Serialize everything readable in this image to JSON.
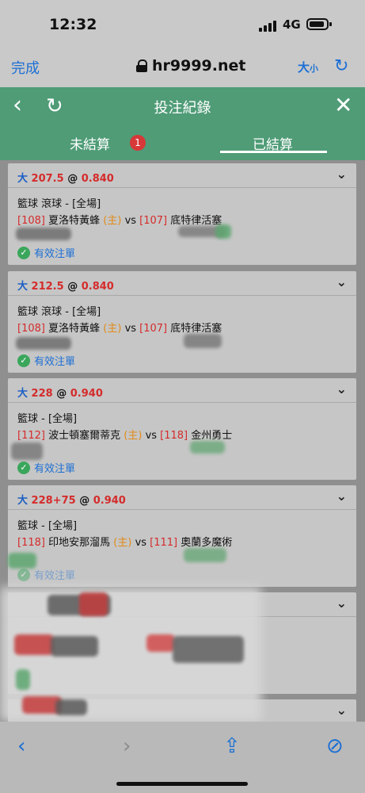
{
  "status": {
    "time": "12:32",
    "network": "4G"
  },
  "browser": {
    "done_label": "完成",
    "url": "hr9999.net",
    "text_size": "大",
    "text_size_small": "小"
  },
  "header": {
    "title": "投注紀錄",
    "back_icon": "back-arrow-icon",
    "refresh_icon": "refresh-icon",
    "close_icon": "close-icon"
  },
  "tabs": [
    {
      "label": "未結算",
      "badge": "1",
      "active": false
    },
    {
      "label": "已結算",
      "active": true
    }
  ],
  "bets": [
    {
      "direction": "大",
      "line": "207.5",
      "at": "@",
      "odds": "0.840",
      "sport": "籃球 滾球 - [全場]",
      "home_code": "[108]",
      "home_team": "夏洛特黃蜂",
      "home_tag": "(主)",
      "vs": "vs",
      "away_code": "[107]",
      "away_team": "底特律活塞",
      "status": "有效注單"
    },
    {
      "direction": "大",
      "line": "212.5",
      "at": "@",
      "odds": "0.840",
      "sport": "籃球 滾球 - [全場]",
      "home_code": "[108]",
      "home_team": "夏洛特黃蜂",
      "home_tag": "(主)",
      "vs": "vs",
      "away_code": "[107]",
      "away_team": "底特律活塞",
      "status": "有效注單"
    },
    {
      "direction": "大",
      "line": "228",
      "at": "@",
      "odds": "0.940",
      "sport": "籃球 - [全場]",
      "home_code": "[112]",
      "home_team": "波士頓塞爾蒂克",
      "home_tag": "(主)",
      "vs": "vs",
      "away_code": "[118]",
      "away_team": "金州勇士",
      "status": "有效注單"
    },
    {
      "direction": "大",
      "line": "228+75",
      "at": "@",
      "odds": "0.940",
      "sport": "籃球 - [全場]",
      "home_code": "[118]",
      "home_team": "印地安那溜馬",
      "home_tag": "(主)",
      "vs": "vs",
      "away_code": "[111]",
      "away_team": "奧蘭多魔術",
      "status": "有效注單"
    }
  ],
  "colors": {
    "header_green": "#4f9c77",
    "odds_red": "#d52b2b",
    "link_blue": "#1c6fd4",
    "home_orange": "#e38a17"
  }
}
